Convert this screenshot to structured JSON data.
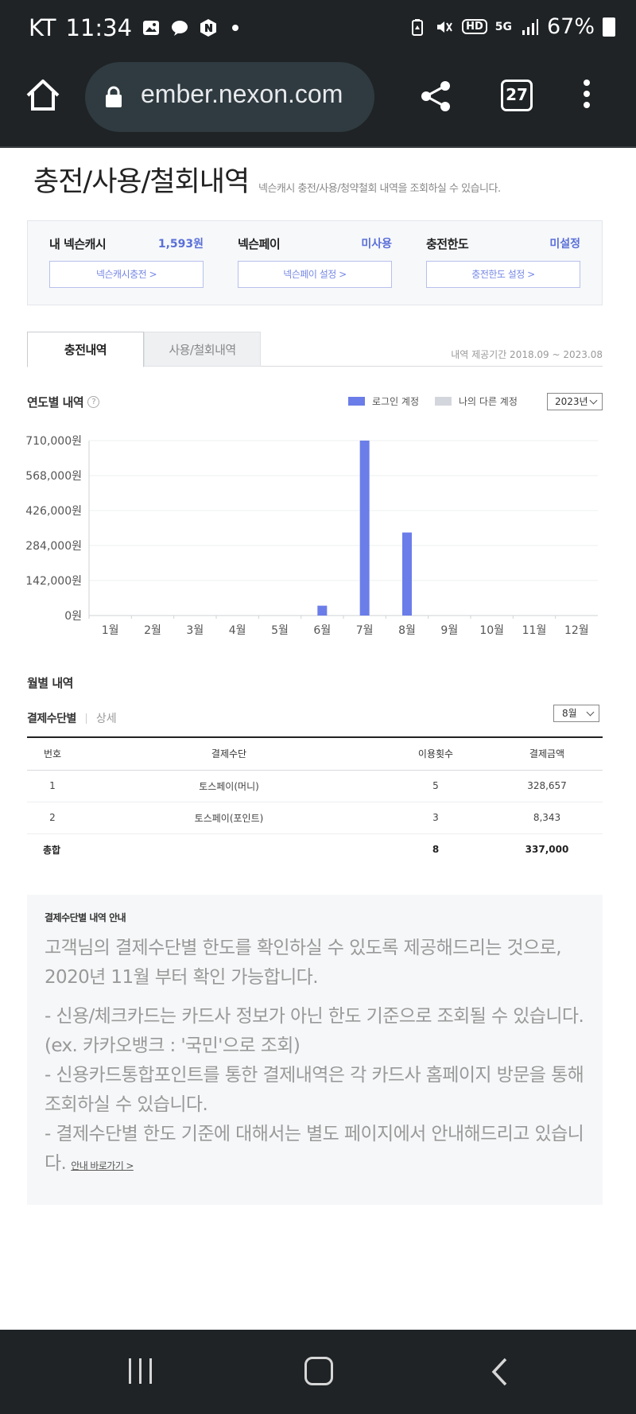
{
  "status": {
    "carrier": "KT",
    "time": "11:34",
    "battery": "67%",
    "hd": "HD",
    "net": "5G"
  },
  "browser": {
    "url": "ember.nexon.com",
    "tab_count": "27"
  },
  "page": {
    "title": "충전/사용/철회내역",
    "description": "넥슨캐시 충전/사용/청약철회 내역을 조회하실 수 있습니다."
  },
  "cash": {
    "nexon_cash_label": "내 넥슨캐시",
    "nexon_cash_value": "1,593원",
    "nexon_cash_button": "넥슨캐시충전 >",
    "nexon_pay_label": "넥슨페이",
    "nexon_pay_value": "미사용",
    "nexon_pay_button": "넥슨페이 설정 >",
    "limit_label": "충전한도",
    "limit_value": "미설정",
    "limit_button": "충전한도 설정 >"
  },
  "tabs": {
    "charge": "충전내역",
    "use": "사용/철회내역",
    "period": "내역 제공기간 2018.09 ~ 2023.08"
  },
  "yearly": {
    "title": "연도별 내역",
    "help": "?",
    "legend_login": "로그인 계정",
    "legend_other": "나의 다른 계정",
    "year_select": "2023년",
    "colors": {
      "login": "#6b7de8",
      "other": "#d3d6dd"
    }
  },
  "chart_data": {
    "type": "bar",
    "categories": [
      "1월",
      "2월",
      "3월",
      "4월",
      "5월",
      "6월",
      "7월",
      "8월",
      "9월",
      "10월",
      "11월",
      "12월"
    ],
    "series": [
      {
        "name": "로그인 계정",
        "values": [
          0,
          0,
          0,
          0,
          0,
          40000,
          710000,
          337000,
          0,
          0,
          0,
          0
        ]
      }
    ],
    "yticks": [
      "710,000원",
      "568,000원",
      "426,000원",
      "284,000원",
      "142,000원",
      "0원"
    ],
    "ylim": [
      0,
      710000
    ],
    "grid": true
  },
  "monthly": {
    "title": "월별 내역",
    "subtab_method": "결제수단별",
    "subtab_detail": "상세",
    "month_select": "8월",
    "headers": [
      "번호",
      "결제수단",
      "이용횟수",
      "결제금액"
    ],
    "rows": [
      [
        "1",
        "토스페이(머니)",
        "5",
        "328,657"
      ],
      [
        "2",
        "토스페이(포인트)",
        "3",
        "8,343"
      ]
    ],
    "total": [
      "총합",
      "",
      "8",
      "337,000"
    ]
  },
  "notice": {
    "title": "결제수단별 내역 안내",
    "p1": "고객님의 결제수단별 한도를 확인하실 수 있도록 제공해드리는 것으로, 2020년 11월 부터 확인 가능합니다.",
    "p2": "- 신용/체크카드는 카드사 정보가 아닌 한도 기준으로 조회될 수 있습니다. (ex. 카카오뱅크 : '국민'으로 조회)",
    "p3": "- 신용카드통합포인트를 통한 결제내역은 각 카드사 홈페이지 방문을 통해 조회하실 수 있습니다.",
    "p4": "- 결제수단별 한도 기준에 대해서는 별도 페이지에서 안내해드리고 있습니다.",
    "link": "안내 바로가기 >"
  }
}
